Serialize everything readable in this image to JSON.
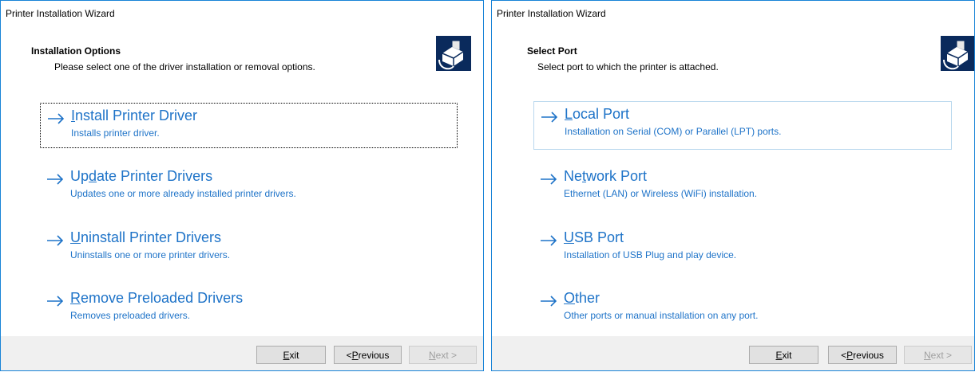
{
  "windows": [
    {
      "title": "Printer Installation Wizard",
      "header": {
        "title": "Installation Options",
        "subtitle": "Please select one of the driver installation or removal options.",
        "icon": "printer-wizard-icon"
      },
      "options": [
        {
          "pre": "",
          "mnemonic": "I",
          "post": "nstall Printer Driver",
          "description": "Installs printer driver.",
          "state": "focused"
        },
        {
          "pre": "Up",
          "mnemonic": "d",
          "post": "ate Printer Drivers",
          "description": "Updates one or more already installed printer drivers.",
          "state": "normal"
        },
        {
          "pre": "",
          "mnemonic": "U",
          "post": "ninstall Printer Drivers",
          "description": "Uninstalls one or more printer drivers.",
          "state": "normal"
        },
        {
          "pre": "",
          "mnemonic": "R",
          "post": "emove Preloaded Drivers",
          "description": "Removes preloaded drivers.",
          "state": "normal"
        }
      ],
      "buttons": {
        "exit": {
          "pre": "",
          "mnemonic": "E",
          "post": "xit",
          "enabled": true
        },
        "previous": {
          "pre": "< ",
          "mnemonic": "P",
          "post": "revious",
          "enabled": true
        },
        "next": {
          "pre": "",
          "mnemonic": "N",
          "post": "ext >",
          "enabled": false
        }
      }
    },
    {
      "title": "Printer Installation Wizard",
      "header": {
        "title": "Select Port",
        "subtitle": "Select port to which the printer is attached.",
        "icon": "printer-wizard-icon"
      },
      "options": [
        {
          "pre": "",
          "mnemonic": "L",
          "post": "ocal Port",
          "description": "Installation on Serial (COM) or Parallel (LPT) ports.",
          "state": "hovered"
        },
        {
          "pre": "Ne",
          "mnemonic": "t",
          "post": "work Port",
          "description": "Ethernet (LAN) or Wireless (WiFi) installation.",
          "state": "normal"
        },
        {
          "pre": "",
          "mnemonic": "U",
          "post": "SB Port",
          "description": "Installation of USB Plug and play device.",
          "state": "normal"
        },
        {
          "pre": "",
          "mnemonic": "O",
          "post": "ther",
          "description": "Other ports or manual installation on any port.",
          "state": "normal"
        }
      ],
      "buttons": {
        "exit": {
          "pre": "",
          "mnemonic": "E",
          "post": "xit",
          "enabled": true
        },
        "previous": {
          "pre": "< ",
          "mnemonic": "P",
          "post": "revious",
          "enabled": true
        },
        "next": {
          "pre": "",
          "mnemonic": "N",
          "post": "ext >",
          "enabled": false
        }
      }
    }
  ],
  "colors": {
    "link": "#1e73c8",
    "window_border": "#1883d7",
    "footer_bg": "#f0f0f0",
    "hover_border": "#b9d8ee"
  }
}
